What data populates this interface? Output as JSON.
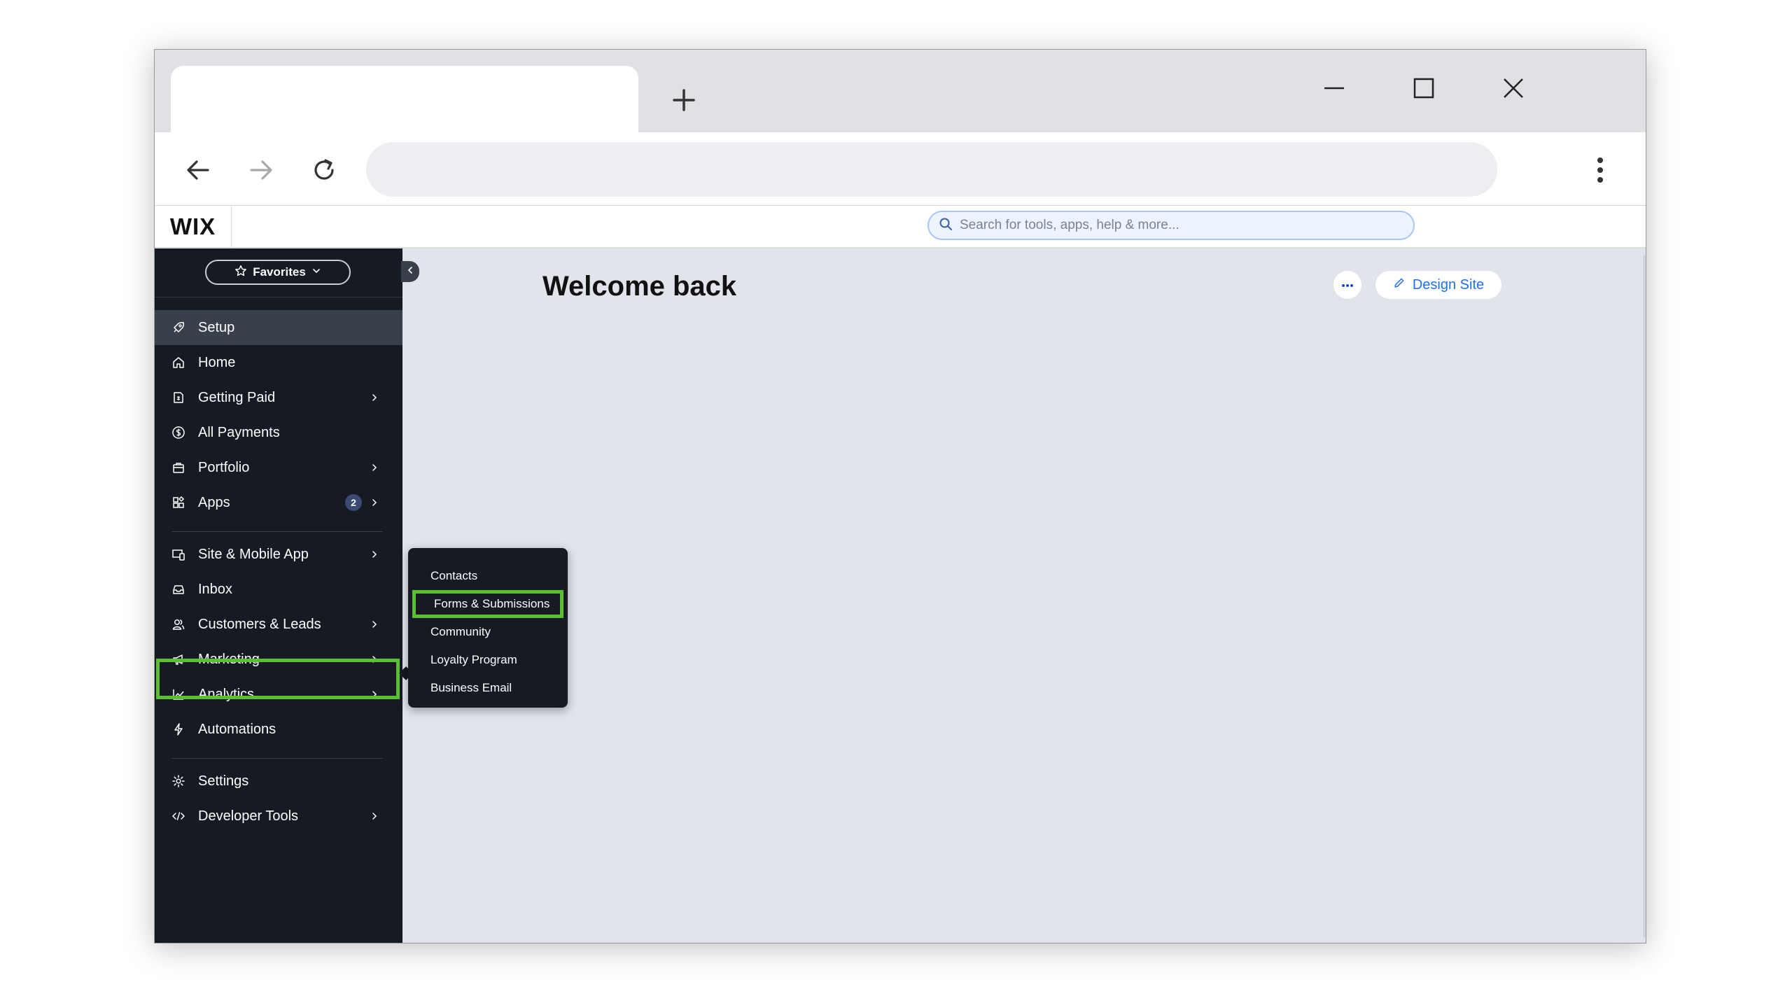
{
  "browser": {
    "new_tab_icon": "plus-icon",
    "window_controls": [
      "minimize-icon",
      "maximize-icon",
      "close-icon"
    ],
    "nav_icons": [
      "back-arrow-icon",
      "forward-arrow-icon",
      "reload-icon"
    ],
    "menu_icon": "vertical-dots-icon"
  },
  "wix_header": {
    "logo": "WIX",
    "search_placeholder": "Search for tools, apps, help & more..."
  },
  "sidebar": {
    "favorites_label": "Favorites",
    "items": [
      {
        "label": "Setup",
        "icon": "rocket-icon"
      },
      {
        "label": "Home",
        "icon": "home-icon"
      },
      {
        "label": "Getting Paid",
        "icon": "invoice-icon"
      },
      {
        "label": "All Payments",
        "icon": "dollar-circle-icon"
      },
      {
        "label": "Portfolio",
        "icon": "briefcase-icon"
      },
      {
        "label": "Apps",
        "icon": "apps-icon",
        "badge": "2"
      },
      {
        "label": "Site & Mobile App",
        "icon": "devices-icon"
      },
      {
        "label": "Inbox",
        "icon": "inbox-icon"
      },
      {
        "label": "Customers & Leads",
        "icon": "people-icon"
      },
      {
        "label": "Marketing",
        "icon": "megaphone-icon"
      },
      {
        "label": "Analytics",
        "icon": "chart-line-icon"
      },
      {
        "label": "Automations",
        "icon": "bolt-icon"
      },
      {
        "label": "Settings",
        "icon": "gear-icon"
      },
      {
        "label": "Developer Tools",
        "icon": "code-icon"
      }
    ]
  },
  "flyout": {
    "items": [
      "Contacts",
      "Forms & Submissions",
      "Community",
      "Loyalty Program",
      "Business Email"
    ]
  },
  "main": {
    "title": "Welcome back",
    "design_site_label": "Design Site"
  },
  "colors": {
    "sidebar_bg": "#151a23",
    "highlight": "#5bbf34",
    "accent": "#1f6ff0",
    "main_bg": "#e1e4eb"
  }
}
